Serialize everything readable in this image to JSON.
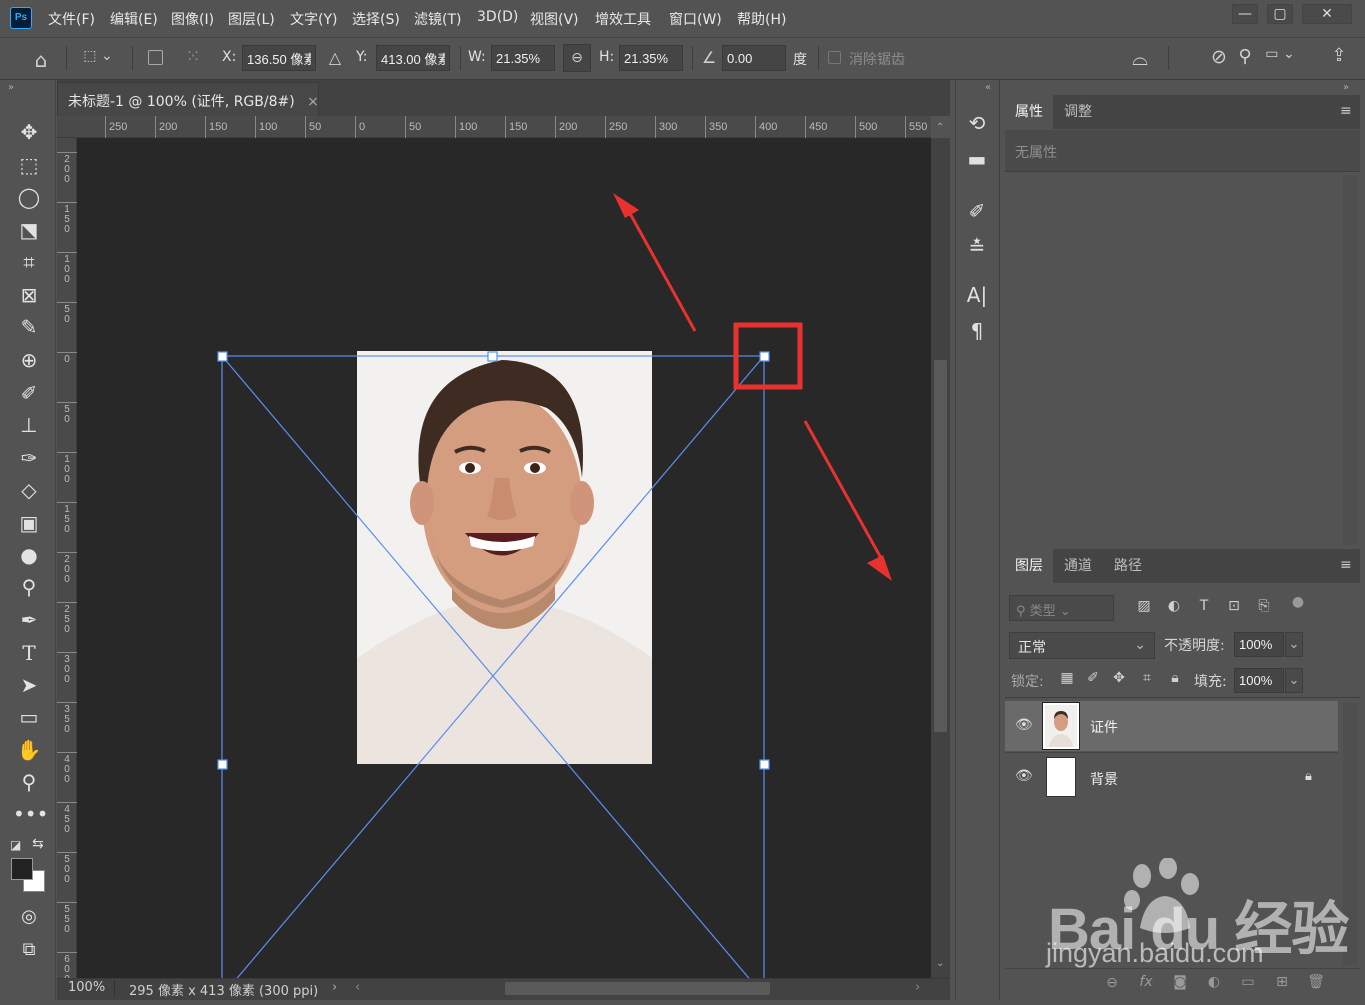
{
  "app": {
    "logo": "Ps"
  },
  "menu": [
    "文件(F)",
    "编辑(E)",
    "图像(I)",
    "图层(L)",
    "文字(Y)",
    "选择(S)",
    "滤镜(T)",
    "3D(D)",
    "视图(V)",
    "增效工具",
    "窗口(W)",
    "帮助(H)"
  ],
  "window_controls": {
    "minimize": "—",
    "maximize": "▢",
    "close": "✕"
  },
  "options": {
    "x_label": "X:",
    "x_value": "136.50 像素",
    "y_label": "Y:",
    "y_value": "413.00 像素",
    "w_label": "W:",
    "w_value": "21.35%",
    "h_label": "H:",
    "h_value": "21.35%",
    "angle_value": "0.00",
    "angle_unit": "度",
    "antialias_label": "消除锯齿"
  },
  "document": {
    "tab_title": "未标题-1 @ 100% (证件, RGB/8#)",
    "close_glyph": "×",
    "ruler_h": [
      "250",
      "200",
      "150",
      "100",
      "50",
      "0",
      "50",
      "100",
      "150",
      "200",
      "250",
      "300",
      "350",
      "400",
      "450",
      "500",
      "550"
    ],
    "ruler_v": [
      "2\n0\n0",
      "1\n5\n0",
      "1\n0\n0",
      "5\n0",
      "0",
      "5\n0",
      "1\n0\n0",
      "1\n5\n0",
      "2\n0\n0",
      "2\n5\n0",
      "3\n0\n0",
      "3\n5\n0",
      "4\n0\n0",
      "4\n5\n0",
      "5\n0\n0",
      "5\n5\n0",
      "6\n0\n0"
    ],
    "zoom": "100%",
    "doc_info": "295 像素 x 413 像素 (300 ppi)"
  },
  "panels": {
    "properties_tabs": [
      "属性",
      "调整"
    ],
    "properties_empty": "无属性",
    "layers_tabs": [
      "图层",
      "通道",
      "路径"
    ],
    "filter_placeholder": "类型",
    "blend_mode": "正常",
    "opacity_label": "不透明度:",
    "opacity_value": "100%",
    "lock_label": "锁定:",
    "fill_label": "填充:",
    "fill_value": "100%",
    "layers": [
      {
        "name": "证件",
        "selected": true
      },
      {
        "name": "背景",
        "locked": true
      }
    ]
  },
  "watermark": {
    "brand": "Bai du 经验",
    "url": "jingyan.baidu.com"
  },
  "colors": {
    "accent_red": "#e8322f",
    "transform_blue": "#5b8ff0",
    "canvas": "#282828",
    "ui": "#535353"
  }
}
